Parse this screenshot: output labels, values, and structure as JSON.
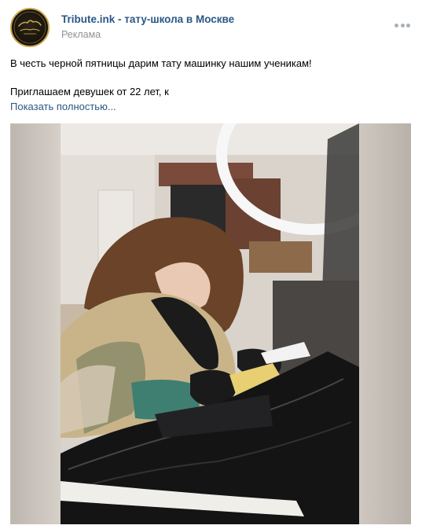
{
  "post": {
    "author": "Tribute.ink - тату-школа в Москве",
    "ad_label": "Реклама",
    "avatar_logo_text": "Tribute",
    "text_lines": [
      "В честь черной пятницы дарим тату машинку нашим ученикам!",
      "Приглашаем девушек от 22 лет, к"
    ],
    "show_more": "Показать полностью..."
  },
  "colors": {
    "link": "#2a5885",
    "muted": "#939393",
    "logo_gold": "#c9a34a"
  },
  "icons": {
    "more": "more-dots-icon"
  }
}
